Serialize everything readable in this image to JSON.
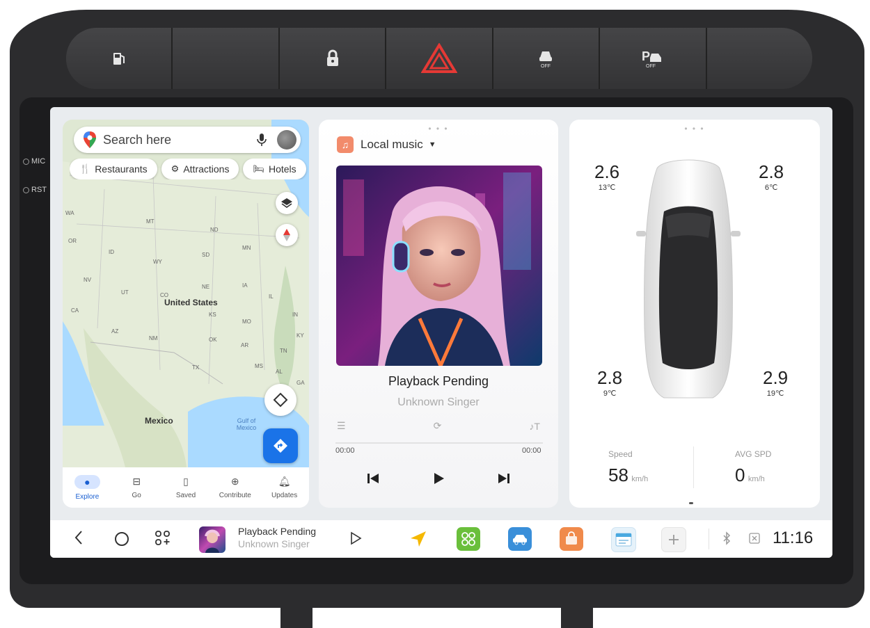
{
  "hardware": {
    "side_mic": "MIC",
    "side_rst": "RST",
    "hazard_color": "#e53935",
    "buttons": [
      {
        "icon": "fuel-cap-icon"
      },
      {
        "icon": "blank-icon"
      },
      {
        "icon": "lock-icon"
      },
      {
        "icon": "hazard-icon"
      },
      {
        "icon": "esp-off-icon",
        "label": "OFF"
      },
      {
        "icon": "park-assist-off-icon",
        "label": "OFF"
      },
      {
        "icon": "blank-icon"
      }
    ]
  },
  "map": {
    "search_placeholder": "Search here",
    "chips": [
      "Restaurants",
      "Attractions",
      "Hotels"
    ],
    "country_label": "United States",
    "mexico_label": "Mexico",
    "gulf_label": "Gulf of Mexico",
    "states": [
      "WA",
      "MT",
      "ND",
      "OR",
      "SD",
      "MN",
      "WY",
      "ID",
      "NV",
      "UT",
      "NE",
      "IA",
      "CA",
      "CO",
      "KS",
      "MO",
      "IL",
      "IN",
      "AZ",
      "NM",
      "OK",
      "AR",
      "TN",
      "KY",
      "TX",
      "MS",
      "AL",
      "GA"
    ],
    "nav": [
      {
        "label": "Explore",
        "icon": "pin-icon",
        "active": true
      },
      {
        "label": "Go",
        "icon": "commute-icon"
      },
      {
        "label": "Saved",
        "icon": "bookmark-icon"
      },
      {
        "label": "Contribute",
        "icon": "plus-circle-icon"
      },
      {
        "label": "Updates",
        "icon": "bell-icon"
      }
    ],
    "accent": "#1a73e8"
  },
  "music": {
    "source": "Local music",
    "title": "Playback Pending",
    "artist": "Unknown Singer",
    "time_current": "00:00",
    "time_total": "00:00"
  },
  "tpms": {
    "front_left": {
      "pressure": "2.6",
      "temp": "13℃"
    },
    "front_right": {
      "pressure": "2.8",
      "temp": "6℃"
    },
    "rear_left": {
      "pressure": "2.8",
      "temp": "9℃"
    },
    "rear_right": {
      "pressure": "2.9",
      "temp": "19℃"
    },
    "speed_label": "Speed",
    "speed_value": "58",
    "speed_unit": "km/h",
    "avg_label": "AVG SPD",
    "avg_value": "0",
    "avg_unit": "km/h"
  },
  "dock": {
    "now_playing_title": "Playback Pending",
    "now_playing_artist": "Unknown Singer",
    "time": "11:16"
  }
}
